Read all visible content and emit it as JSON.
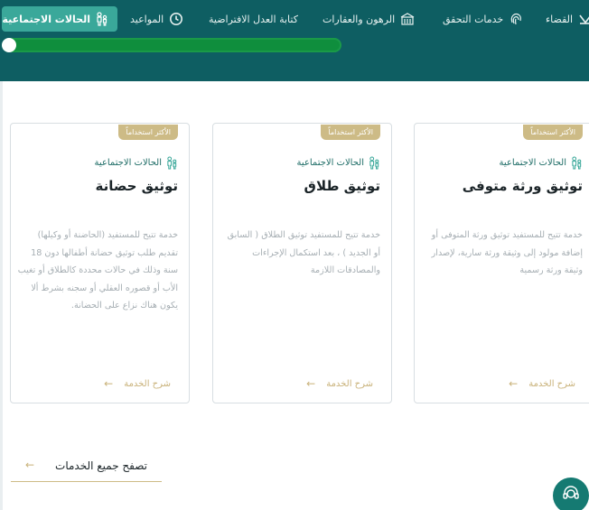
{
  "nav": {
    "items": [
      {
        "label": "القضاء",
        "icon": "scales-icon"
      },
      {
        "label": "خدمات التحقق",
        "icon": "fingerprint-icon"
      },
      {
        "label": "الرهون والعقارات",
        "icon": "building-icon"
      },
      {
        "label": "كتابة العدل الافتراضية",
        "icon": ""
      },
      {
        "label": "المواعيد",
        "icon": "clock-icon"
      },
      {
        "label": "الحالات الاجتماعية",
        "icon": "family-icon",
        "active": true
      }
    ]
  },
  "cards": [
    {
      "badge": "الأكثر استخداماً",
      "category": "الحالات الاجتماعية",
      "title": "توثيق ورثة متوفى",
      "description": "خدمة تتيح للمستفيد توثيق ورثة المتوفى أو إضافة مولود إلى وثيقة ورثة سارية، لإصدار وثيقة ورثة رسمية",
      "link": "شرح الخدمة"
    },
    {
      "badge": "الأكثر استخداماً",
      "category": "الحالات الاجتماعية",
      "title": "توثيق طلاق",
      "description": "خدمة تتيح للمستفيد توثيق الطلاق ( السابق أو الجديد ) ، بعد استكمال الإجراءات والمصادقات اللازمة",
      "link": "شرح الخدمة"
    },
    {
      "badge": "الأكثر استخداماً",
      "category": "الحالات الاجتماعية",
      "title": "توثيق حضانة",
      "description": "خدمة تتيح للمستفيد (الحاضنة أو وكيلها) تقديم طلب توثيق حضانة أطفالها دون 18 سنة وذلك في حالات محددة كالطلاق أو تغيب الأب أو قصوره العقلي أو سجنه بشرط ألا يكون هناك نزاع على الحضانة.",
      "link": "شرح الخدمة"
    }
  ],
  "browse": {
    "label": "تصفح جميع الخدمات"
  },
  "colors": {
    "primary": "#0e5e62",
    "accent": "#cdbb86",
    "active": "#3aa89a",
    "progress": "#0f8e3d"
  }
}
